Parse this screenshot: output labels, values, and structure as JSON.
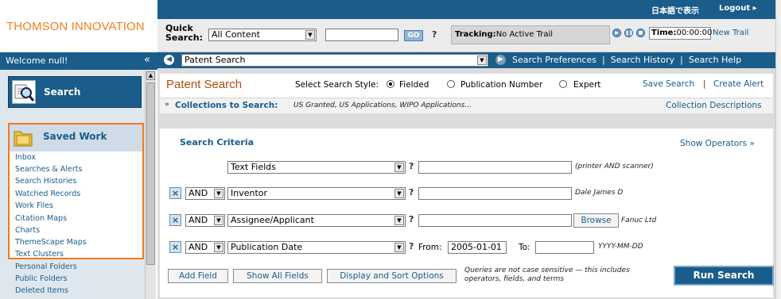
{
  "brand": {
    "logo_text": "THOMSON INNOVATION"
  },
  "welcome": {
    "text": "Welcome null!",
    "collapse": "«"
  },
  "sidebar": {
    "search_label": "Search",
    "saved_work_label": "Saved Work",
    "links": [
      "Inbox",
      "Searches & Alerts",
      "Search Histories",
      "Watched Records",
      "Work Files",
      "Citation Maps",
      "Charts",
      "ThemeScape Maps",
      "Text Clusters",
      "Personal Folders",
      "Public Folders",
      "Deleted Items"
    ]
  },
  "top": {
    "language_link": "日本語で表示",
    "logout": "Logout ▸"
  },
  "quick_search": {
    "label_line1": "Quick",
    "label_line2": "Search:",
    "scope_value": "All Content",
    "input_value": "",
    "go_label": "GO",
    "help": "?"
  },
  "tracking": {
    "label": "Tracking:",
    "value": "No Active Trail",
    "time_label": "Time:",
    "time_value": "00:00:00",
    "new_trail": "New Trail"
  },
  "patent_bar": {
    "select_value": "Patent Search",
    "links": [
      "Search Preferences",
      "Search History",
      "Search Help"
    ]
  },
  "page": {
    "title": "Patent Search",
    "style_label": "Select Search Style:",
    "styles": [
      "Fielded",
      "Publication Number",
      "Expert"
    ],
    "selected_style": "Fielded",
    "save_search": "Save Search",
    "create_alert": "Create Alert",
    "collections_label": "Collections to Search:",
    "collections_value": "US Granted, US Applications, WIPO Applications...",
    "collection_desc": "Collection Descriptions"
  },
  "criteria": {
    "title": "Search Criteria",
    "show_operators": "Show Operators",
    "rows": [
      {
        "operator": "",
        "field": "Text Fields",
        "value": "",
        "hint": "(printer AND scanner)"
      },
      {
        "operator": "AND",
        "field": "Inventor",
        "value": "",
        "hint": "Dale James D"
      },
      {
        "operator": "AND",
        "field": "Assignee/Applicant",
        "value": "",
        "browse": "Browse",
        "hint": "Fanuc Ltd"
      },
      {
        "operator": "AND",
        "field": "Publication Date",
        "from_label": "From:",
        "from_value": "2005-01-01",
        "to_label": "To:",
        "to_value": "",
        "hint": "YYYY-MM-DD"
      }
    ],
    "help": "?",
    "add_field": "Add Field",
    "show_all_fields": "Show All Fields",
    "display_sort": "Display and Sort Options",
    "case_note_line1": "Queries are not case sensitive — this includes",
    "case_note_line2": "operators, fields, and terms",
    "run_search": "Run Search"
  },
  "colors": {
    "brand_blue": "#1a5c8a",
    "accent_orange": "#f07a1e",
    "title_rust": "#b04a12"
  }
}
